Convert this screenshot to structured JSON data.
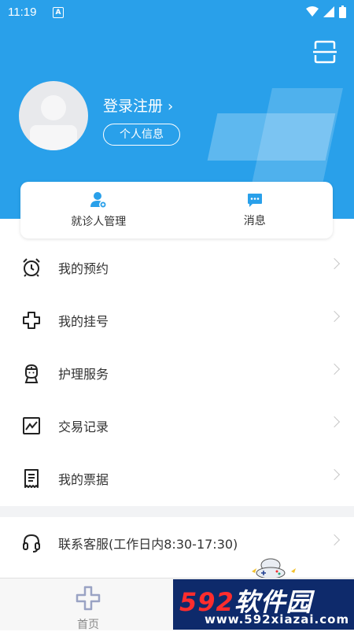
{
  "status_bar": {
    "time": "11:19",
    "notification_badge": "A"
  },
  "header": {
    "login_label": "登录注册",
    "profile_button": "个人信息"
  },
  "quick_actions": [
    {
      "label": "就诊人管理",
      "icon": "user-manage-icon"
    },
    {
      "label": "消息",
      "icon": "message-icon"
    }
  ],
  "menu": [
    {
      "label": "我的预约",
      "icon": "alarm-clock-icon"
    },
    {
      "label": "我的挂号",
      "icon": "plus-cross-icon"
    },
    {
      "label": "护理服务",
      "icon": "nurse-icon"
    },
    {
      "label": "交易记录",
      "icon": "chart-icon"
    },
    {
      "label": "我的票据",
      "icon": "receipt-icon"
    }
  ],
  "service": {
    "label": "联系客服(工作日内8:30-17:30)",
    "icon": "headset-icon"
  },
  "tabbar": {
    "home_label": "首页"
  },
  "watermark": {
    "big_prefix": "592",
    "big_suffix": "软件园",
    "url": "www.592xiazai.com"
  },
  "colors": {
    "primary": "#29a0ea",
    "background": "#ffffff",
    "divider": "#f2f3f5"
  }
}
